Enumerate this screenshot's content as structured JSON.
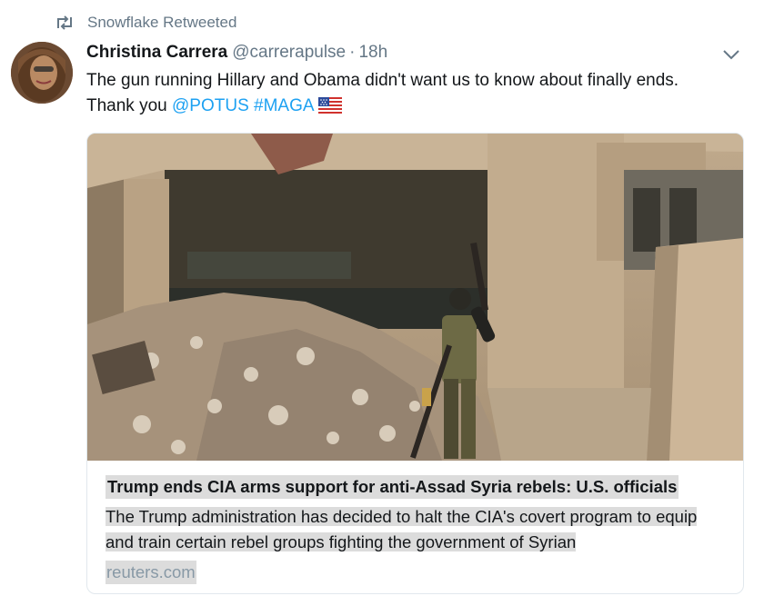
{
  "retweet": {
    "label": "Snowflake Retweeted",
    "icon": "retweet-icon"
  },
  "tweet": {
    "author_name": "Christina Carrera",
    "author_handle": "@carrerapulse",
    "separator": "·",
    "time": "18h",
    "text_line1": "The gun running Hillary and Obama didn't want us to know about finally ends.",
    "text_prefix": "Thank you ",
    "mention": "@POTUS",
    "hashtag": "#MAGA",
    "emoji": "us-flag-icon"
  },
  "card": {
    "title": "Trump ends CIA arms support for anti-Assad Syria rebels: U.S. officials",
    "description": "The Trump administration has decided to halt the CIA's covert program to equip and train certain rebel groups fighting the government of Syrian",
    "domain": "reuters.com"
  },
  "colors": {
    "link": "#1da1f2",
    "muted": "#657786",
    "text": "#14171a",
    "border": "#e1e8ed"
  }
}
